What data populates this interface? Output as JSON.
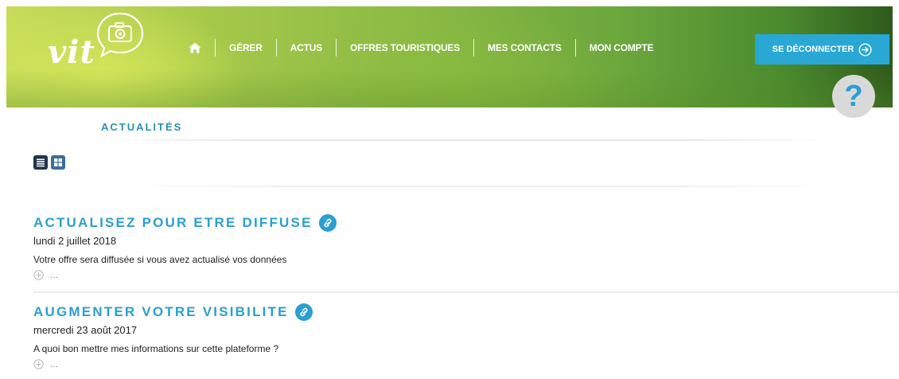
{
  "header": {
    "logo_text": "vit",
    "nav": [
      {
        "label": ""
      },
      {
        "label": "GÉRER"
      },
      {
        "label": "ACTUS"
      },
      {
        "label": "OFFRES TOURISTIQUES"
      },
      {
        "label": "MES CONTACTS"
      },
      {
        "label": "MON COMPTE"
      }
    ],
    "logout_label": "SE DÉCONNECTER",
    "help_label": "?"
  },
  "section": {
    "title": "ACTUALITÉS"
  },
  "articles": [
    {
      "title": "ACTUALISEZ POUR ETRE DIFFUSE",
      "date": "lundi 2 juillet 2018",
      "description": "Votre offre sera diffusée si vous avez actualisé vos données",
      "more": "..."
    },
    {
      "title": "AUGMENTER VOTRE VISIBILITE",
      "date": "mercredi 23 août 2017",
      "description": "A quoi bon mettre mes informations sur cette plateforme ?",
      "more": "..."
    }
  ],
  "icons": {
    "home": "home-icon",
    "logout": "arrow-right-circle-icon",
    "link": "link-icon",
    "plus": "plus-circle-icon",
    "list_view": "list-view-icon",
    "grid_view": "grid-view-icon"
  },
  "colors": {
    "accent": "#29a8d6",
    "title": "#2a8fb4",
    "list_toggle": "#213448",
    "grid_toggle": "#3d6e9a"
  }
}
